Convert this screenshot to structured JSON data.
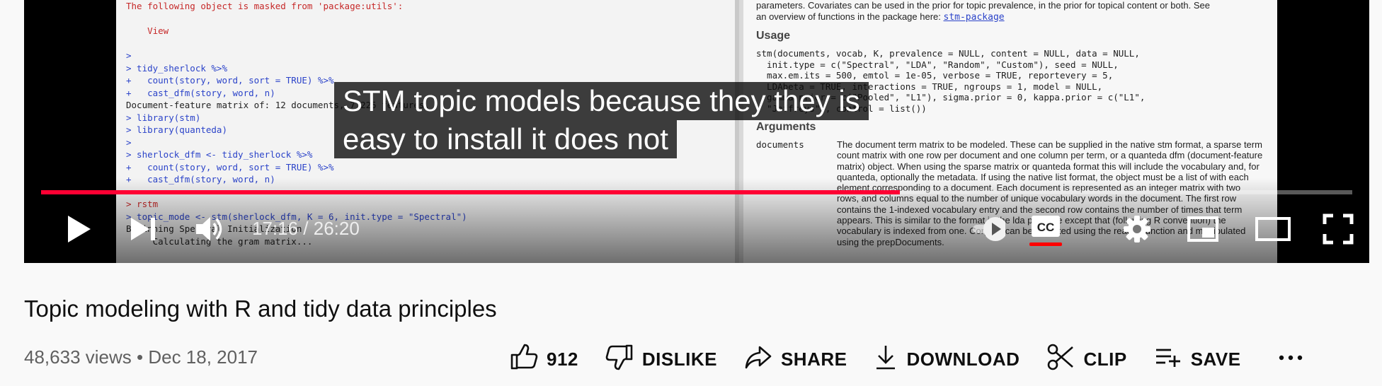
{
  "player": {
    "caption_line1": "STM topic models because they they is",
    "caption_line2": "easy to install it does not",
    "time_display": "17:16 / 26:20",
    "progress_fraction": 0.655,
    "console": {
      "lines": [
        {
          "text": "The following object is masked from 'package:utils':",
          "color": "red"
        },
        {
          "text": "",
          "color": "red"
        },
        {
          "text": "    View",
          "color": "red"
        },
        {
          "text": "",
          "color": "red"
        },
        {
          "text": ">",
          "color": "blue"
        },
        {
          "text": "> tidy_sherlock %>%",
          "color": "blue"
        },
        {
          "text": "+   count(story, word, sort = TRUE) %>%",
          "color": "blue"
        },
        {
          "text": "+   cast_dfm(story, word, n)",
          "color": "blue"
        },
        {
          "text": "Document-feature matrix of: 12 documents, 7,225 features.",
          "color": "black"
        },
        {
          "text": "> library(stm)",
          "color": "blue"
        },
        {
          "text": "> library(quanteda)",
          "color": "blue"
        },
        {
          "text": ">",
          "color": "blue"
        },
        {
          "text": "> sherlock_dfm <- tidy_sherlock %>%",
          "color": "blue"
        },
        {
          "text": "+   count(story, word, sort = TRUE) %>%",
          "color": "blue"
        },
        {
          "text": "+   cast_dfm(story, word, n)",
          "color": "blue"
        },
        {
          "text": ">",
          "color": "blue"
        },
        {
          "text": "> rstm",
          "color": "red"
        },
        {
          "text": "> topic_mode <- stm(sherlock_dfm, K = 6, init.type = \"Spectral\")",
          "color": "blue"
        },
        {
          "text": "Beginning Spectral Initialization",
          "color": "black"
        },
        {
          "text": "     Calculating the gram matrix...",
          "color": "black"
        }
      ]
    },
    "help": {
      "intro_line1": "parameters. Covariates can be used in the prior for topic prevalence, in the prior for topical content or both. See",
      "intro_line2": "an overview of functions in the package here: ",
      "intro_link": "stm-package",
      "usage_heading": "Usage",
      "usage_code": "stm(documents, vocab, K, prevalence = NULL, content = NULL, data = NULL,\n  init.type = c(\"Spectral\", \"LDA\", \"Random\", \"Custom\"), seed = NULL,\n  max.em.its = 500, emtol = 1e-05, verbose = TRUE, reportevery = 5,\n  LDAbeta = TRUE, interactions = TRUE, ngroups = 1, model = NULL,\n  gamma.prior = c(\"Pooled\", \"L1\"), sigma.prior = 0, kappa.prior = c(\"L1\",\n  \"Jeffreys\"), control = list())",
      "arguments_heading": "Arguments",
      "arg_name": "documents",
      "arg_text": "The document term matrix to be modeled. These can be supplied in the native stm format, a sparse term count matrix with one row per document and one column per term, or a quanteda dfm (document-feature matrix) object. When using the sparse matrix or quanteda format this will include the vocabulary and, for quanteda, optionally the metadata. If using the native list format, the object must be a list of with each element corresponding to a document. Each document is represented as an integer matrix with two rows, and columns equal to the number of unique vocabulary words in the document. The first row contains the 1-indexed vocabulary entry and the second row contains the number of times that term appears. This is similar to the format in the lda package except that (following R convention) the vocabulary is indexed from one. Corpora can be imported using the reader function and manipulated using the prepDocuments."
    },
    "colors": {
      "progress": "#ff0033",
      "captions_underline": "#ff0000"
    }
  },
  "video": {
    "title": "Topic modeling with R and tidy data principles",
    "views": "48,633 views",
    "separator": "•",
    "date": "Dec 18, 2017"
  },
  "actions": {
    "like_count": "912",
    "dislike": "DISLIKE",
    "share": "SHARE",
    "download": "DOWNLOAD",
    "clip": "CLIP",
    "save": "SAVE"
  },
  "icons": [
    "play-icon",
    "next-icon",
    "volume-icon",
    "autoplay-icon",
    "captions-icon",
    "settings-icon",
    "miniplayer-icon",
    "theater-icon",
    "fullscreen-icon",
    "like-icon",
    "dislike-icon",
    "share-icon",
    "download-icon",
    "clip-icon",
    "save-icon",
    "more-icon"
  ]
}
